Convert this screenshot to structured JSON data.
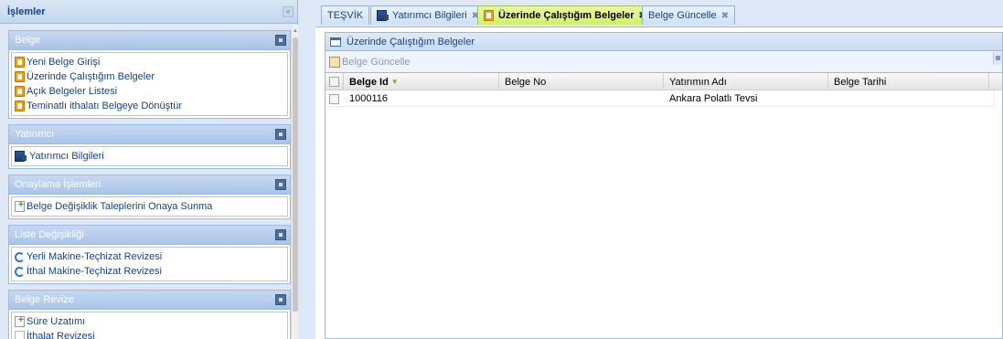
{
  "west": {
    "title": "İşlemler",
    "sections": {
      "belge": {
        "title": "Belge",
        "items": [
          "Yeni Belge Girişi",
          "Üzerinde Çalıştığım Belgeler",
          "Açık Belgeler Listesi",
          "Teminatlı ithalatı Belgeye Dönüştür"
        ]
      },
      "yatirimci": {
        "title": "Yatırımcı",
        "items": [
          "Yatırımcı Bilgileri"
        ]
      },
      "onaylama": {
        "title": "Onaylama İşlemleri",
        "items": [
          "Belge Değişiklik Taleplerini Onaya Sunma"
        ]
      },
      "liste": {
        "title": "Liste Değişikliği",
        "items": [
          "Yerli Makine-Teçhizat Revizesi",
          "İthal Makine-Teçhizat Revizesi"
        ]
      },
      "revize": {
        "title": "Belge Revize",
        "items": [
          "Süre Uzatımı",
          "İthalat Revizesi"
        ]
      }
    }
  },
  "tabs": [
    {
      "label": "TEŞVİK"
    },
    {
      "label": "Yatırımcı Bilgileri",
      "close": "✖"
    },
    {
      "label": "Üzerinde Çalıştığım Belgeler",
      "close": "✖"
    },
    {
      "label": "Belge Güncelle",
      "close": "✖"
    }
  ],
  "panel": {
    "title": "Üzerinde Çalıştığım Belgeler",
    "toolbar_button": "Belge Güncelle",
    "columns": [
      "Belge Id",
      "Belge No",
      "Yatırımın Adı",
      "Belge Tarihi"
    ],
    "rows": [
      {
        "id": "1000116",
        "no": "",
        "name": "Ankara Polatlı Tevsi",
        "date": ""
      }
    ]
  },
  "colors": {
    "accent": "#15428b",
    "active_tab": "#d2ef6a",
    "panel_border": "#99bbe8"
  },
  "icons": {
    "collapse": "double-chevron-left-icon",
    "section_tool": "collapse-icon"
  }
}
